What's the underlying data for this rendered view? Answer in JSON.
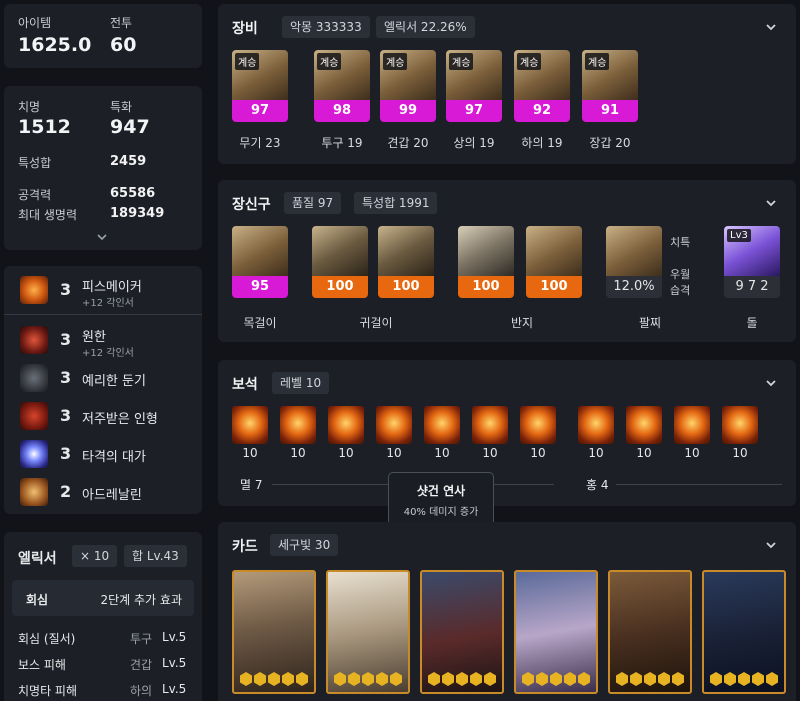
{
  "colors": {
    "bg": "#111318",
    "panel": "#1c1f26",
    "pink": "#d81ad6",
    "orange": "#e8680f",
    "card_border": "#c98a2a"
  },
  "stats": {
    "item_label": "아이템",
    "item_value": "1625.0",
    "combat_label": "전투",
    "combat_value": "60",
    "crit_label": "치명",
    "crit_value": "1512",
    "special_label": "특화",
    "special_value": "947",
    "sum_label": "특성합",
    "sum_value": "2459",
    "atk_label": "공격력",
    "atk_value": "65586",
    "hp_label": "최대 생명력",
    "hp_value": "189349"
  },
  "engravings": [
    {
      "level": "3",
      "name": "피스메이커",
      "sub": "+12 각인서"
    },
    {
      "level": "3",
      "name": "원한",
      "sub": "+12 각인서"
    },
    {
      "level": "3",
      "name": "예리한 둔기"
    },
    {
      "level": "3",
      "name": "저주받은 인형"
    },
    {
      "level": "3",
      "name": "타격의 대가"
    },
    {
      "level": "2",
      "name": "아드레날린"
    }
  ],
  "elixir": {
    "title": "엘릭서",
    "count": "× 10",
    "total": "합 Lv.43",
    "effect_name": "회심",
    "effect_desc": "2단계 추가 효과",
    "rows": [
      {
        "name": "회심 (질서)",
        "slot": "투구",
        "lv": "Lv.5"
      },
      {
        "name": "보스 피해",
        "slot": "견갑",
        "lv": "Lv.5"
      },
      {
        "name": "치명타 피해",
        "slot": "하의",
        "lv": "Lv.5"
      }
    ]
  },
  "equipment": {
    "title": "장비",
    "chip1": "악몽 333333",
    "chip2": "엘릭서 22.26%",
    "items": [
      {
        "tag": "계승",
        "quality": "97",
        "label": "무기 23"
      },
      {
        "tag": "계승",
        "quality": "98",
        "label": "투구 19"
      },
      {
        "tag": "계승",
        "quality": "99",
        "label": "견갑 20"
      },
      {
        "tag": "계승",
        "quality": "97",
        "label": "상의 19"
      },
      {
        "tag": "계승",
        "quality": "92",
        "label": "하의 19"
      },
      {
        "tag": "계승",
        "quality": "91",
        "label": "장갑 20"
      }
    ]
  },
  "accessories": {
    "title": "장신구",
    "chip1": "품질 97",
    "chip2": "특성합 1991",
    "items": [
      {
        "quality": "95"
      },
      {
        "quality": "100"
      },
      {
        "quality": "100"
      },
      {
        "quality": "100"
      },
      {
        "quality": "100"
      },
      {
        "quality": "12.0%"
      }
    ],
    "labels": [
      "목걸이",
      "귀걸이",
      "반지",
      "팔찌",
      "돌"
    ],
    "bracelet_side": [
      "치특",
      "우월",
      "습격"
    ],
    "stone_tag": "Lv3",
    "stone_value": "9 7 2"
  },
  "gems": {
    "title": "보석",
    "chip": "레벨 10",
    "values": [
      "10",
      "10",
      "10",
      "10",
      "10",
      "10",
      "10",
      "10",
      "10",
      "10",
      "10"
    ],
    "left_label": "멸 7",
    "right_label": "홍 4",
    "tooltip_title": "샷건 연사",
    "tooltip_desc": "40% 데미지 증가"
  },
  "cards": {
    "title": "카드",
    "chip": "세구빛 30"
  }
}
